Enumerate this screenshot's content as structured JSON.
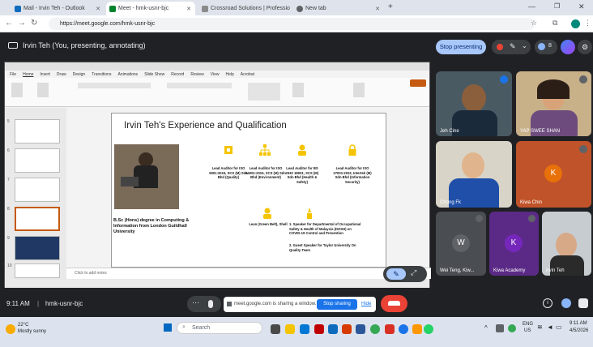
{
  "browser": {
    "tabs": [
      {
        "label": "Mail - Irvin Teh - Outlook",
        "color": "#0f6cbd"
      },
      {
        "label": "Meet - hmk-usnr-bjc",
        "color": "#00832d"
      },
      {
        "label": "Crossroad Solutions | Professio",
        "color": "#8a8a8a"
      },
      {
        "label": "New tab",
        "color": "#5f6368"
      }
    ],
    "url": "https://meet.google.com/hmk-usnr-bjc"
  },
  "meet": {
    "presenter": "Irvin Teh (You, presenting, annotating)",
    "stop_presenting": "Stop presenting",
    "participant_count": "8",
    "meeting_code": "hmk-usnr-bjc",
    "time": "9:11 AM",
    "share_msg": "meet.google.com is sharing a window.",
    "stop_sharing": "Stop sharing",
    "hide": "Hide",
    "participants": [
      {
        "name": "Jeh Cine"
      },
      {
        "name": "YAP SWEE SHAN"
      },
      {
        "name": "Chong Fk"
      },
      {
        "name": "Kiwa Chin",
        "initial": "K",
        "color": "#e8710a"
      },
      {
        "name": "Wei Teng, Kiw...",
        "initial": "W",
        "color": "#5f6368"
      },
      {
        "name": "Kiwa Academy",
        "initial": "K",
        "color": "#7627bb"
      },
      {
        "name": "Irvin Teh"
      }
    ]
  },
  "ppt": {
    "menu": [
      "File",
      "Home",
      "Insert",
      "Draw",
      "Design",
      "Transitions",
      "Animations",
      "Slide Show",
      "Record",
      "Review",
      "View",
      "Help",
      "Acrobat"
    ],
    "slide_title": "Irvin Teh's Experience and Qualification",
    "certs": [
      {
        "text": "Lead Auditor for ISO 9001:2015, SCS (M) Sdn Bhd (Quality)"
      },
      {
        "text": "Lead Auditor for ISO 14001:2015, SCS (M) Sdn Bhd (Environment)"
      },
      {
        "text": "Lead Auditor for BS OHS 18001, SCS (M) Sdn Bhd (Health & Safety)"
      },
      {
        "text": "Lead Auditor for ISO 27001:2022, Intertek (M) Sdn Bhd (Information Security)"
      }
    ],
    "degree": "B.Sc (Hons) degree in Computing & Information from London Guildhall University",
    "lean": "Lean (Green Belt), Shell",
    "speaker1": "1.  Speaker for Departmental of Occupational Safety & Health of Malaysia (DOSH) on COVID-19 Control and Prevention",
    "speaker2": "2.  Guest Speaker for Taylor University On Quality Team",
    "notes": "Click to add notes",
    "slide_nums": [
      "5",
      "6",
      "7",
      "8",
      "9",
      "10"
    ]
  },
  "taskbar": {
    "weather_temp": "22°C",
    "weather_desc": "Mostly sunny",
    "search": "Search",
    "lang": "ENG",
    "region": "US",
    "clock_time": "9:11 AM",
    "clock_date": "4/5/2026"
  }
}
